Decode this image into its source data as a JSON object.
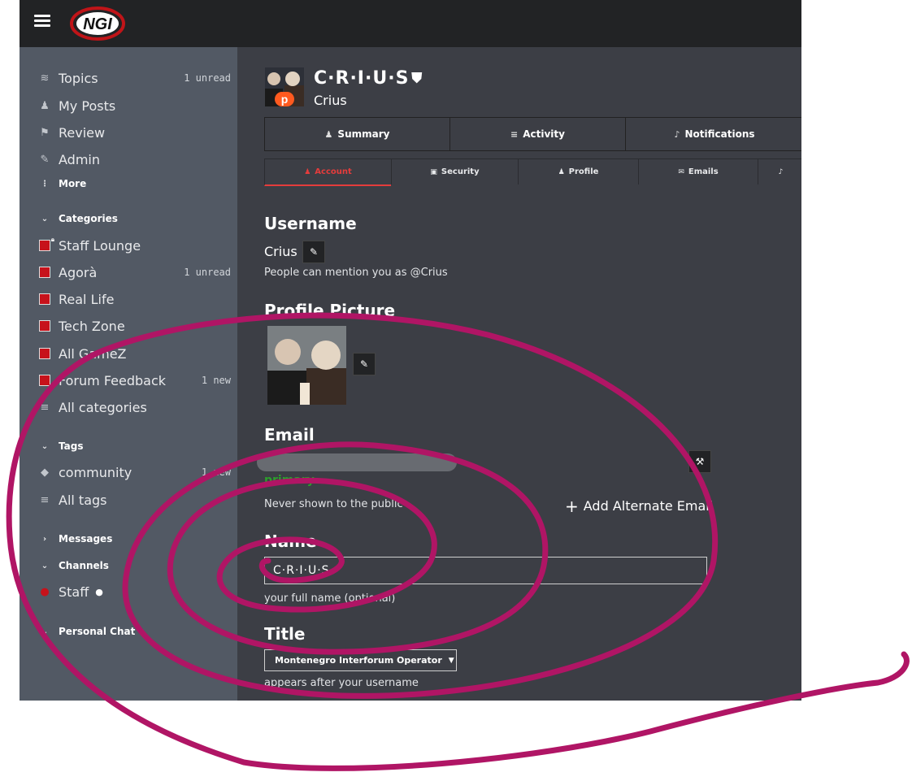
{
  "sidebar": {
    "items": [
      {
        "icon": "layers-icon",
        "glyph": "≋",
        "label": "Topics",
        "count": "1 unread"
      },
      {
        "icon": "user-icon",
        "glyph": "♟",
        "label": "My Posts",
        "count": ""
      },
      {
        "icon": "flag-icon",
        "glyph": "⚑",
        "label": "Review",
        "count": ""
      },
      {
        "icon": "wrench-icon",
        "glyph": "✎",
        "label": "Admin",
        "count": ""
      }
    ],
    "more_label": "More",
    "categories_heading": "Categories",
    "categories": [
      {
        "label": "Staff Lounge",
        "count": "",
        "locked": true
      },
      {
        "label": "Agorà",
        "count": "1 unread",
        "locked": false
      },
      {
        "label": "Real Life",
        "count": "",
        "locked": false
      },
      {
        "label": "Tech Zone",
        "count": "",
        "locked": false
      },
      {
        "label": "All GameZ",
        "count": "",
        "locked": false
      },
      {
        "label": "Forum Feedback",
        "count": "1 new",
        "locked": false
      }
    ],
    "all_categories": "All categories",
    "tags_heading": "Tags",
    "tags": [
      {
        "label": "community",
        "count": "1 new"
      }
    ],
    "all_tags": "All tags",
    "messages_heading": "Messages",
    "channels_heading": "Channels",
    "channel_staff": "Staff",
    "personal_chat_heading": "Personal Chat"
  },
  "profile": {
    "display_name": "C·R·I·U·S",
    "username": "Crius"
  },
  "tabs_primary": [
    {
      "icon": "user-icon",
      "glyph": "♟",
      "label": "Summary"
    },
    {
      "icon": "list-icon",
      "glyph": "≡",
      "label": "Activity"
    },
    {
      "icon": "bell-icon",
      "glyph": "♪",
      "label": "Notifications"
    }
  ],
  "tabs_secondary": [
    {
      "icon": "user-icon",
      "glyph": "♟",
      "label": "Account",
      "active": true
    },
    {
      "icon": "lock-icon",
      "glyph": "▣",
      "label": "Security",
      "active": false
    },
    {
      "icon": "user-icon",
      "glyph": "♟",
      "label": "Profile",
      "active": false
    },
    {
      "icon": "envelope-icon",
      "glyph": "✉",
      "label": "Emails",
      "active": false
    }
  ],
  "account": {
    "username_heading": "Username",
    "username_value": "Crius",
    "mention_hint": "People can mention you as @Crius",
    "profile_picture_heading": "Profile Picture",
    "email_heading": "Email",
    "email_primary": "primary",
    "email_hint": "Never shown to the public",
    "add_alternate_email": "Add Alternate Email",
    "name_heading": "Name",
    "name_value": "C·R·I·U·S",
    "name_hint": "your full name (optional)",
    "title_heading": "Title",
    "title_value": "Montenegro Interforum Operator",
    "title_hint": "appears after your username"
  },
  "logo_text": "NGI",
  "colors": {
    "header": "#222325",
    "sidebar": "#525964",
    "main": "#3c3e45",
    "category_red": "#c7121b",
    "active_tab": "#e53c3c",
    "primary_green": "#2c9f2c",
    "scribble": "#b01565"
  }
}
